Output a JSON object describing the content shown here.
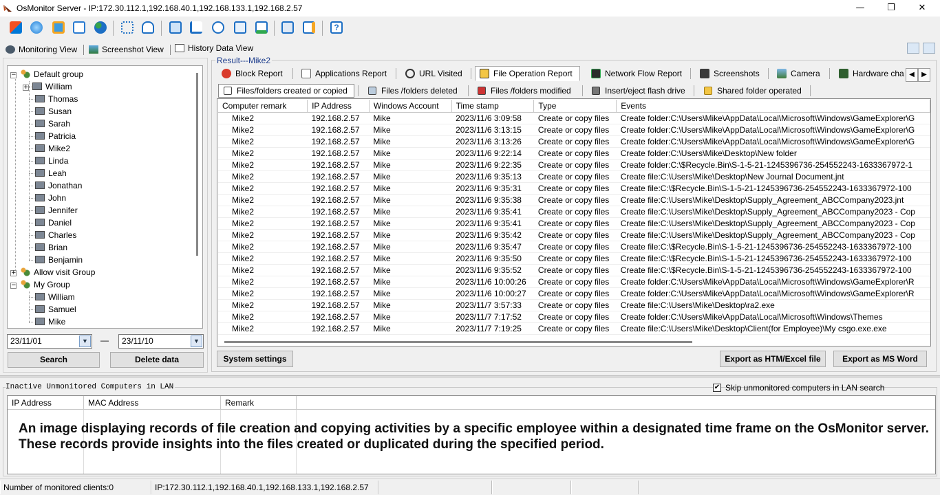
{
  "app": {
    "title": "OsMonitor Server  -  IP:172.30.112.1,192.168.40.1,192.168.133.1,192.168.2.57",
    "minimize": "—",
    "maximize": "❐",
    "close": "✕"
  },
  "view_tabs": [
    "Monitoring View",
    "Screenshot View",
    "History Data View"
  ],
  "tree": {
    "default_group": "Default group",
    "default_members": [
      "William",
      "Thomas",
      "Susan",
      "Sarah",
      "Patricia",
      "Mike2",
      "Linda",
      "Leah",
      "Jonathan",
      "John",
      "Jennifer",
      "Daniel",
      "Charles",
      "Brian",
      "Benjamin"
    ],
    "allow_visit": "Allow visit Group",
    "my_group": "My Group",
    "my_members": [
      "William",
      "Samuel",
      "Mike"
    ]
  },
  "date_from": "23/11/01",
  "date_dash": "—",
  "date_to": "23/11/10",
  "search_btn": "Search",
  "delete_btn": "Delete data",
  "result_label": "Result---Mike2",
  "report_tabs": [
    "Block Report",
    "Applications Report",
    "URL Visited",
    "File Operation Report",
    "Network Flow Report",
    "Screenshots",
    "Camera",
    "Hardware cha"
  ],
  "selected_report_tab": "File Operation Report",
  "sub_tabs": [
    "Files/folders created or copied",
    "Files /folders deleted",
    "Files /folders modified",
    "Insert/eject flash drive",
    "Shared folder operated"
  ],
  "columns": [
    "Computer remark",
    "IP Address",
    "Windows Account",
    "Time stamp",
    "Type",
    "Events"
  ],
  "rows": [
    [
      "Mike2",
      "192.168.2.57",
      "Mike",
      "2023/11/6 3:09:58",
      "Create or copy files",
      "Create folder:C:\\Users\\Mike\\AppData\\Local\\Microsoft\\Windows\\GameExplorer\\G"
    ],
    [
      "Mike2",
      "192.168.2.57",
      "Mike",
      "2023/11/6 3:13:15",
      "Create or copy files",
      "Create folder:C:\\Users\\Mike\\AppData\\Local\\Microsoft\\Windows\\GameExplorer\\G"
    ],
    [
      "Mike2",
      "192.168.2.57",
      "Mike",
      "2023/11/6 3:13:26",
      "Create or copy files",
      "Create folder:C:\\Users\\Mike\\AppData\\Local\\Microsoft\\Windows\\GameExplorer\\G"
    ],
    [
      "Mike2",
      "192.168.2.57",
      "Mike",
      "2023/11/6 9:22:14",
      "Create or copy files",
      "Create folder:C:\\Users\\Mike\\Desktop\\New folder"
    ],
    [
      "Mike2",
      "192.168.2.57",
      "Mike",
      "2023/11/6 9:22:35",
      "Create or copy files",
      "Create folder:C:\\$Recycle.Bin\\S-1-5-21-1245396736-254552243-1633367972-1"
    ],
    [
      "Mike2",
      "192.168.2.57",
      "Mike",
      "2023/11/6 9:35:13",
      "Create or copy files",
      "Create file:C:\\Users\\Mike\\Desktop\\New Journal Document.jnt"
    ],
    [
      "Mike2",
      "192.168.2.57",
      "Mike",
      "2023/11/6 9:35:31",
      "Create or copy files",
      "Create file:C:\\$Recycle.Bin\\S-1-5-21-1245396736-254552243-1633367972-100"
    ],
    [
      "Mike2",
      "192.168.2.57",
      "Mike",
      "2023/11/6 9:35:38",
      "Create or copy files",
      "Create file:C:\\Users\\Mike\\Desktop\\Supply_Agreement_ABCCompany2023.jnt"
    ],
    [
      "Mike2",
      "192.168.2.57",
      "Mike",
      "2023/11/6 9:35:41",
      "Create or copy files",
      "Create file:C:\\Users\\Mike\\Desktop\\Supply_Agreement_ABCCompany2023 - Cop"
    ],
    [
      "Mike2",
      "192.168.2.57",
      "Mike",
      "2023/11/6 9:35:41",
      "Create or copy files",
      "Create file:C:\\Users\\Mike\\Desktop\\Supply_Agreement_ABCCompany2023 - Cop"
    ],
    [
      "Mike2",
      "192.168.2.57",
      "Mike",
      "2023/11/6 9:35:42",
      "Create or copy files",
      "Create file:C:\\Users\\Mike\\Desktop\\Supply_Agreement_ABCCompany2023 - Cop"
    ],
    [
      "Mike2",
      "192.168.2.57",
      "Mike",
      "2023/11/6 9:35:47",
      "Create or copy files",
      "Create file:C:\\$Recycle.Bin\\S-1-5-21-1245396736-254552243-1633367972-100"
    ],
    [
      "Mike2",
      "192.168.2.57",
      "Mike",
      "2023/11/6 9:35:50",
      "Create or copy files",
      "Create file:C:\\$Recycle.Bin\\S-1-5-21-1245396736-254552243-1633367972-100"
    ],
    [
      "Mike2",
      "192.168.2.57",
      "Mike",
      "2023/11/6 9:35:52",
      "Create or copy files",
      "Create file:C:\\$Recycle.Bin\\S-1-5-21-1245396736-254552243-1633367972-100"
    ],
    [
      "Mike2",
      "192.168.2.57",
      "Mike",
      "2023/11/6 10:00:26",
      "Create or copy files",
      "Create folder:C:\\Users\\Mike\\AppData\\Local\\Microsoft\\Windows\\GameExplorer\\R"
    ],
    [
      "Mike2",
      "192.168.2.57",
      "Mike",
      "2023/11/6 10:00:27",
      "Create or copy files",
      "Create folder:C:\\Users\\Mike\\AppData\\Local\\Microsoft\\Windows\\GameExplorer\\R"
    ],
    [
      "Mike2",
      "192.168.2.57",
      "Mike",
      "2023/11/7 3:57:33",
      "Create or copy files",
      "Create file:C:\\Users\\Mike\\Desktop\\ra2.exe"
    ],
    [
      "Mike2",
      "192.168.2.57",
      "Mike",
      "2023/11/7 7:17:52",
      "Create or copy files",
      "Create folder:C:\\Users\\Mike\\AppData\\Local\\Microsoft\\Windows\\Themes"
    ],
    [
      "Mike2",
      "192.168.2.57",
      "Mike",
      "2023/11/7 7:19:25",
      "Create or copy files",
      "Create file:C:\\Users\\Mike\\Desktop\\Client(for Employee)\\My csgo.exe.exe"
    ]
  ],
  "system_settings_btn": "System settings",
  "export_htm_btn": "Export as HTM/Excel file",
  "export_word_btn": "Export as MS Word",
  "bottom_label": "Inactive Unmonitored Computers in LAN",
  "skip_checked": "✔",
  "skip_label": "Skip unmonitored computers in LAN search",
  "lan_columns": [
    "IP Address",
    "MAC Address",
    "Remark"
  ],
  "caption": "An image displaying records of file creation and copying activities by a specific employee within a designated time frame on the OsMonitor server. These records provide insights into the files created or duplicated during the specified period.",
  "status": {
    "clients": "Number of monitored clients:0",
    "ips": "IP:172.30.112.1,192.168.40.1,192.168.133.1,192.168.2.57"
  },
  "colors": {
    "selected_tab_bg": "#ffffff",
    "accent_blue": "#1c3c8c",
    "block_red": "#d93a2b"
  },
  "icons": {
    "toolbar": [
      "windows-icon",
      "globe-icon",
      "settings-icon",
      "report-icon",
      "users-icon",
      "grid-icon",
      "lock-icon",
      "monitor-icon",
      "cast-icon",
      "search-user-icon",
      "network-icon",
      "presentation-icon",
      "export-icon",
      "ip-lock-icon",
      "help-icon"
    ]
  }
}
